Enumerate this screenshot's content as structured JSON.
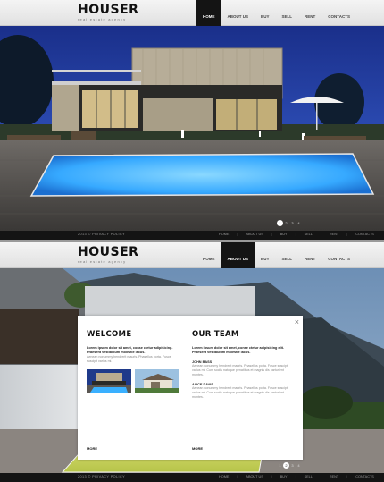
{
  "logo": {
    "title": "HOUSER",
    "subtitle": "real estate agency"
  },
  "nav": [
    {
      "label": "HOME"
    },
    {
      "label": "ABOUT US"
    },
    {
      "label": "BUY"
    },
    {
      "label": "SELL"
    },
    {
      "label": "RENT"
    },
    {
      "label": "CONTACTS"
    }
  ],
  "screen1": {
    "active_nav": "HOME"
  },
  "screen2": {
    "active_nav": "ABOUT US"
  },
  "footer": {
    "copyright": "2013 © PRIVACY POLICY",
    "links": [
      "HOME",
      "ABOUT US",
      "BUY",
      "SELL",
      "RENT",
      "CONTACTS"
    ]
  },
  "pager": {
    "pages": [
      "1",
      "2",
      "3",
      "4"
    ],
    "active_index": 0
  },
  "pager2": {
    "pages": [
      "1",
      "2",
      "3",
      "4"
    ],
    "active_index": 1
  },
  "modal": {
    "close_label": "×",
    "welcome": {
      "title": "WELCOME",
      "lead": "Lorem ipsum dolor sit amet, conse ctetur adipisicing. Praesent vestibulum molestie lacus.",
      "body": "Aenean nonummy hendrerit mauris. Phasellus porta. Fusce suscipit varius mi.",
      "more_label": "MORE"
    },
    "team": {
      "title": "OUR TEAM",
      "lead": "Lorem ipsum dolor sit amet, conse ctetur adipisicing elit. Praesent vestibulum molestie lacus.",
      "members": [
        {
          "name": "JOHN BASS",
          "text": "Aenean nonummy hendrerit mauris. Phasellus porta. Fusce suscipit varius mi. Cum sociis natoque penatibus et magnis dis parturient montes."
        },
        {
          "name": "ALICE DAVIS",
          "text": "Aenean nonummy hendrerit mauris. Phasellus porta. Fusce suscipit varius mi. Cum sociis natoque penatibus et magnis dis parturient montes."
        }
      ],
      "more_label": "MORE"
    }
  },
  "colors": {
    "nav_active": "#141414",
    "footer": "#141414",
    "pool": "#36a9ff"
  }
}
